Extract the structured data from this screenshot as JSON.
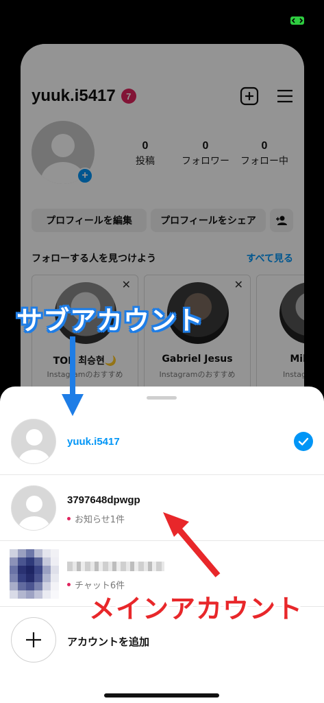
{
  "profile": {
    "username": "yuuk.i5417",
    "notification_count": "7",
    "stats": [
      {
        "value": "0",
        "label": "投稿"
      },
      {
        "value": "0",
        "label": "フォロワー"
      },
      {
        "value": "0",
        "label": "フォロー中"
      }
    ],
    "edit_profile_label": "プロフィールを編集",
    "share_profile_label": "プロフィールをシェア",
    "suggestions_title": "フォローする人を見つけよう",
    "see_all_label": "すべて見る",
    "suggestions": [
      {
        "name": "TOP 최승현🌙",
        "sub": "Instagramのおすすめ"
      },
      {
        "name": "Gabriel Jesus",
        "sub": "Instagramのおすすめ"
      },
      {
        "name": "Miley C",
        "sub": "Instagramのお"
      }
    ]
  },
  "sheet": {
    "accounts": [
      {
        "username": "yuuk.i5417",
        "sub": "",
        "selected": true
      },
      {
        "username": "3797648dpwgp",
        "sub": "お知らせ1件",
        "selected": false
      },
      {
        "username": "",
        "sub": "チャット6件",
        "selected": false
      }
    ],
    "add_account_label": "アカウントを追加"
  },
  "annotations": {
    "sub_account": "サブアカウント",
    "main_account": "メインアカウント"
  },
  "colors": {
    "accent_blue": "#0095f6",
    "badge_red": "#e0245e",
    "annotation_blue": "#1e7de6",
    "annotation_red": "#e8272a"
  }
}
